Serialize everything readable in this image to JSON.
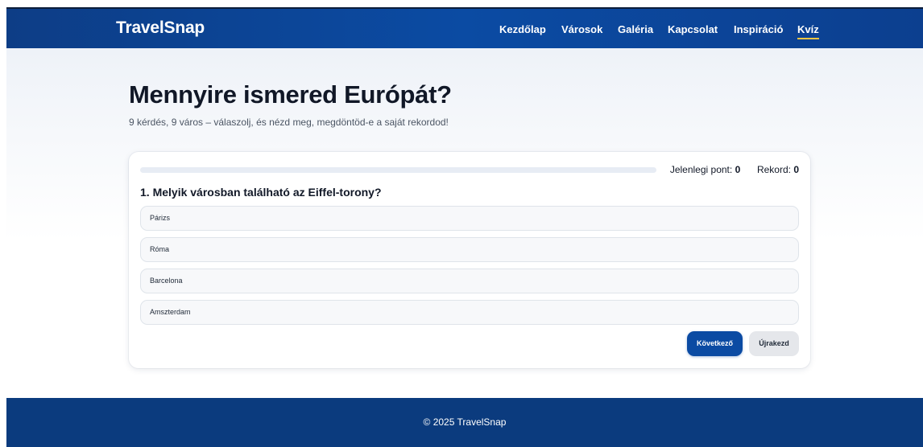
{
  "header": {
    "logo": "TravelSnap",
    "nav": [
      {
        "label": "Kezdőlap"
      },
      {
        "label": "Városok"
      },
      {
        "label": "Galéria"
      },
      {
        "label": "Kapcsolat"
      },
      {
        "label": "Inspiráció"
      },
      {
        "label": "Kvíz",
        "active": true
      }
    ],
    "accent_color": "#f5c542"
  },
  "hero": {
    "title": "Mennyire ismered Európát?",
    "subtitle": "9 kérdés, 9 város – válaszolj, és nézd meg, megdöntöd-e a saját rekordod!"
  },
  "quiz": {
    "progress": 0,
    "score_label": "Jelenlegi pont:",
    "score_value": "0",
    "record_label": "Rekord:",
    "record_value": "0",
    "question": "1. Melyik városban található az Eiffel-torony?",
    "options": [
      "Párizs",
      "Róma",
      "Barcelona",
      "Amszterdam"
    ],
    "next_label": "Következő",
    "restart_label": "Újrakezd"
  },
  "footer": {
    "text": "© 2025 TravelSnap"
  },
  "colors": {
    "brand": "#0b4ba3",
    "footer": "#0b3b7e"
  }
}
